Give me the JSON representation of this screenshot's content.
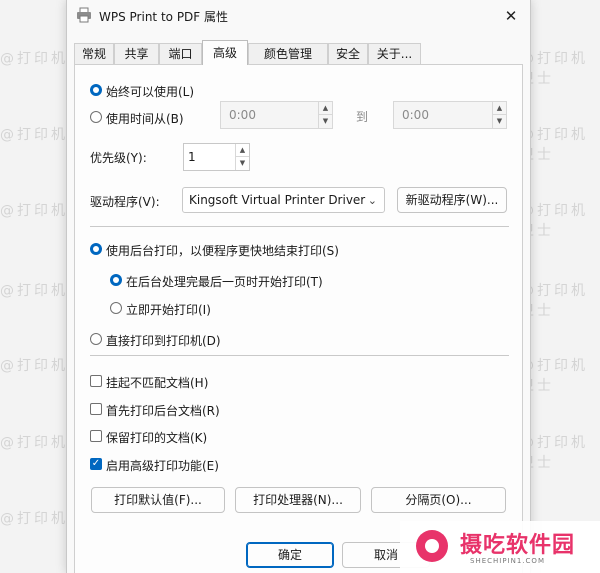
{
  "watermark": "@打印机卫士",
  "window": {
    "title": "WPS Print to PDF 属性",
    "close_glyph": "✕"
  },
  "tabs": [
    {
      "label": "常规"
    },
    {
      "label": "共享"
    },
    {
      "label": "端口"
    },
    {
      "label": "高级"
    },
    {
      "label": "颜色管理"
    },
    {
      "label": "安全"
    },
    {
      "label": "关于..."
    }
  ],
  "availability": {
    "always_label": "始终可以使用(L)",
    "time_label": "使用时间从(B)",
    "from_value": "0:00",
    "to_label": "到",
    "to_value": "0:00"
  },
  "priority": {
    "label": "优先级(Y):",
    "value": "1"
  },
  "driver": {
    "label": "驱动程序(V):",
    "selected": "Kingsoft Virtual Printer Driver",
    "new_button": "新驱动程序(W)..."
  },
  "spool": {
    "spool_label": "使用后台打印，以便程序更快地结束打印(S)",
    "after_last_page_label": "在后台处理完最后一页时开始打印(T)",
    "immediately_label": "立即开始打印(I)",
    "direct_label": "直接打印到打印机(D)"
  },
  "options": [
    {
      "label": "挂起不匹配文档(H)",
      "checked": false
    },
    {
      "label": "首先打印后台文档(R)",
      "checked": false
    },
    {
      "label": "保留打印的文档(K)",
      "checked": false
    },
    {
      "label": "启用高级打印功能(E)",
      "checked": true
    }
  ],
  "bottom_buttons": {
    "defaults": "打印默认值(F)...",
    "processor": "打印处理器(N)...",
    "separator": "分隔页(O)..."
  },
  "dialog_buttons": {
    "ok": "确定",
    "cancel": "取消"
  },
  "brand": {
    "name": "摄吃软件园",
    "url": "SHECHIPIN1.COM"
  },
  "colors": {
    "accent": "#0067c0",
    "brand": "#e8336a"
  }
}
